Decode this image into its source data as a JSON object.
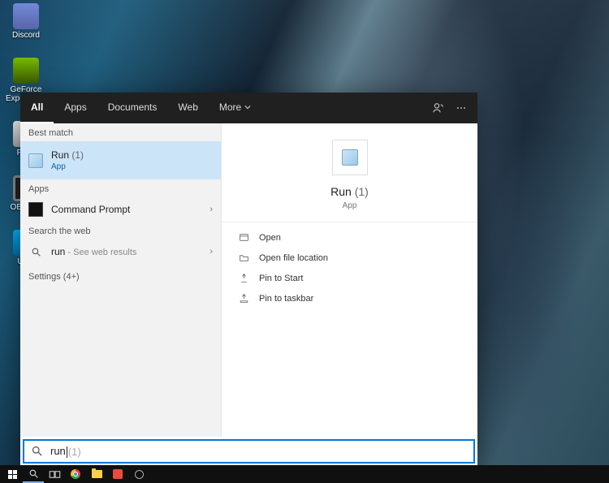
{
  "desktop": {
    "icons": [
      {
        "id": "discord",
        "label": "Discord"
      },
      {
        "id": "nvidia",
        "label": "GeForce Experience"
      },
      {
        "id": "fortnite",
        "label": "For..."
      },
      {
        "id": "obs",
        "label": "OBS S..."
      },
      {
        "id": "up",
        "label": "Up..."
      }
    ]
  },
  "tabs": {
    "all": "All",
    "apps": "Apps",
    "documents": "Documents",
    "web": "Web",
    "more": "More"
  },
  "left": {
    "best_match_hdr": "Best match",
    "selected": {
      "name": "Run",
      "count": "(1)",
      "type": "App"
    },
    "apps_hdr": "Apps",
    "apps": [
      {
        "name": "Command Prompt"
      }
    ],
    "search_web_hdr": "Search the web",
    "web_item": {
      "term": "run",
      "suffix": " - See web results"
    },
    "settings_hdr": "Settings (4+)"
  },
  "detail": {
    "name": "Run",
    "count": "(1)",
    "type": "App",
    "actions": {
      "open": "Open",
      "open_loc": "Open file location",
      "pin_start": "Pin to Start",
      "pin_taskbar": "Pin to taskbar"
    }
  },
  "search": {
    "typed": "run",
    "autocomplete": " (1)"
  }
}
